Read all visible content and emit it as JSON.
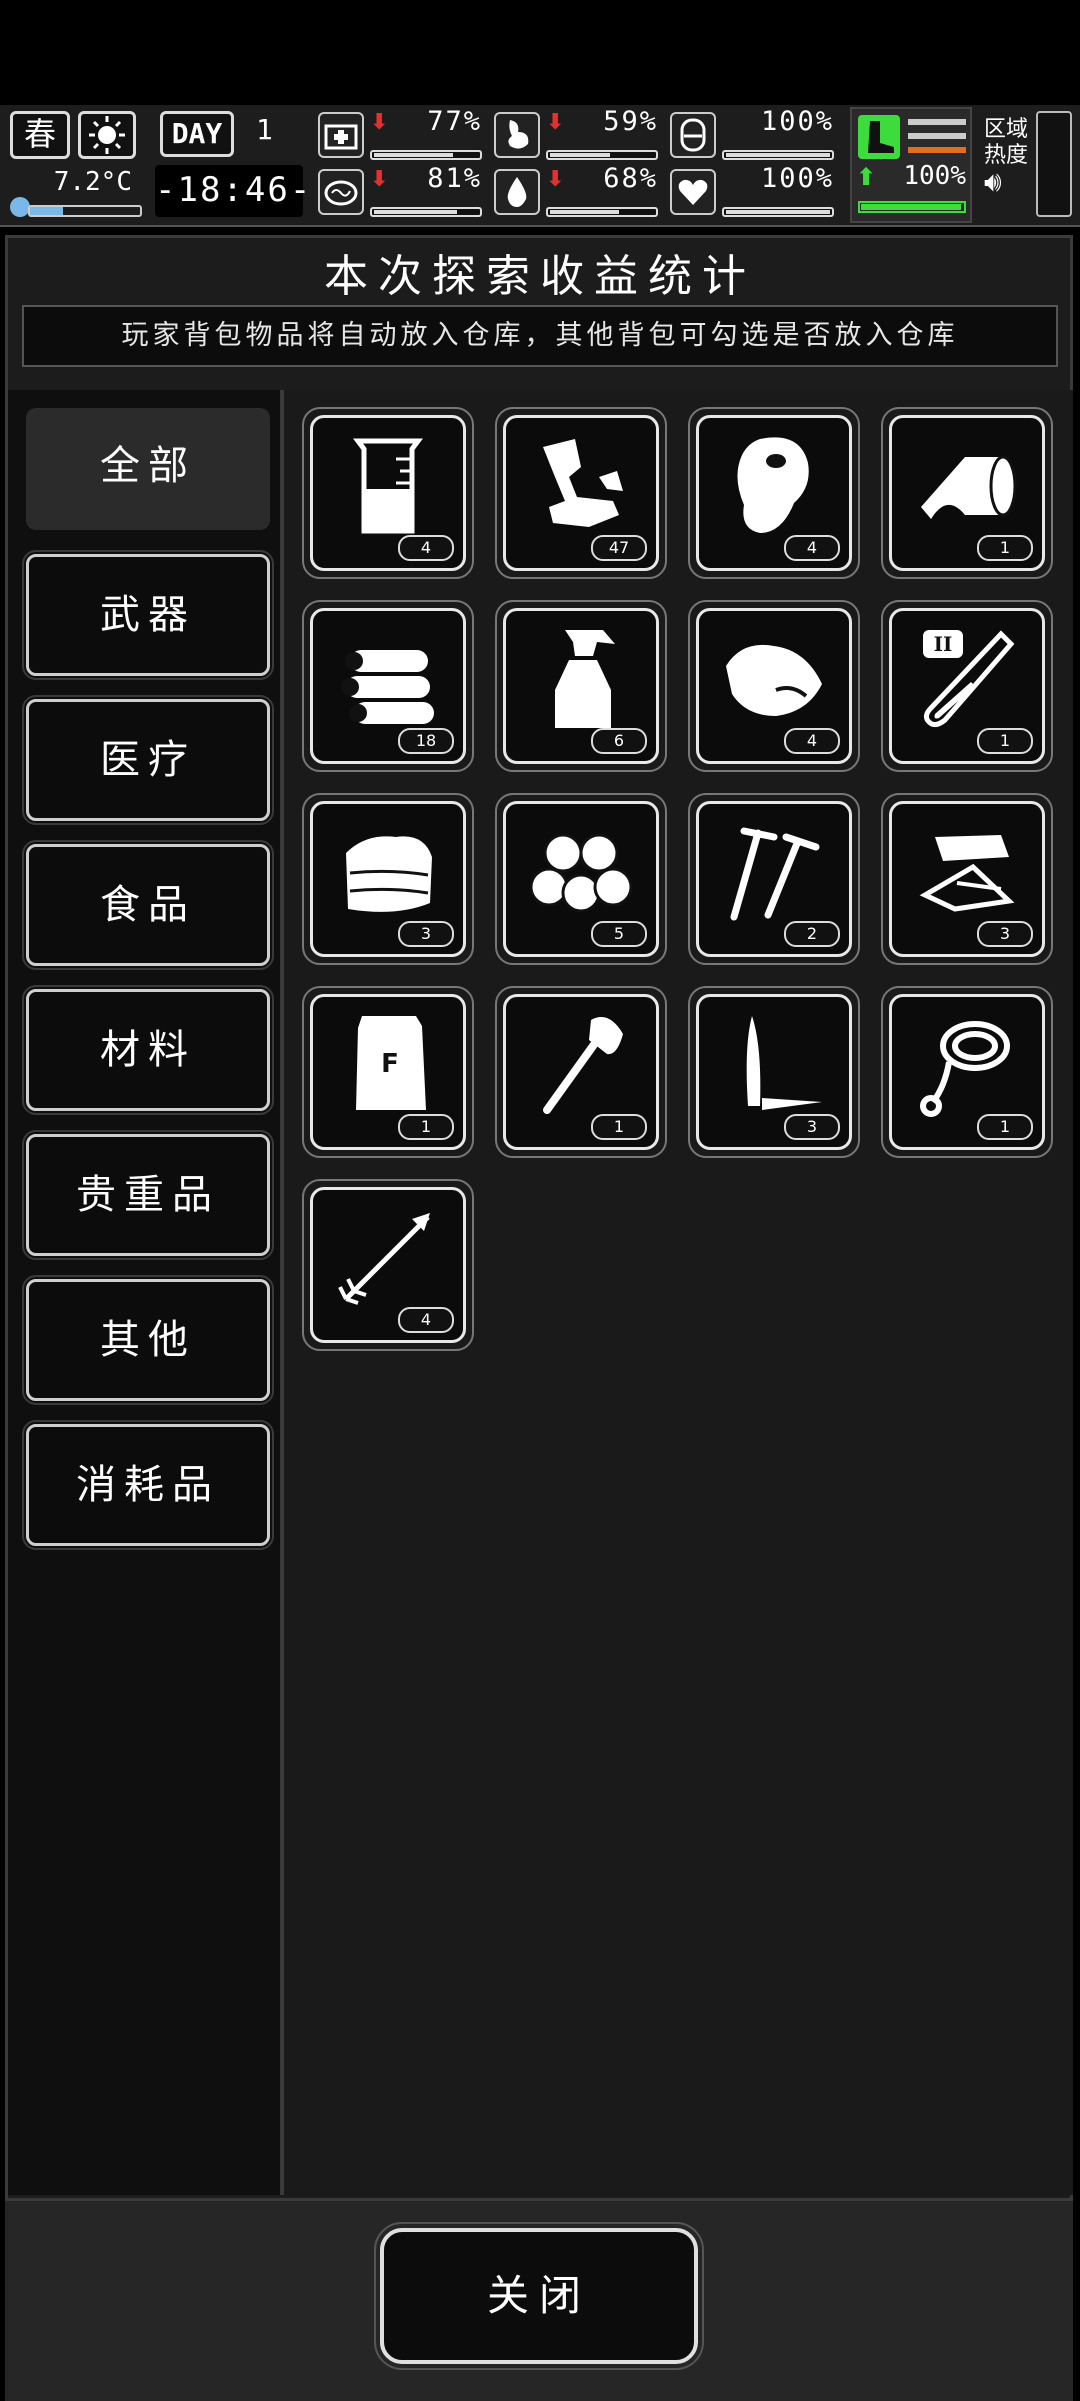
{
  "hud": {
    "season": "春",
    "temperature": "7.2°C",
    "day_label": "DAY",
    "day_number": "1",
    "time": "-18:46-",
    "stats": [
      {
        "name": "health",
        "icon": "medkit-icon",
        "arrow": "down",
        "value": "77%",
        "level": 0.77
      },
      {
        "name": "hunger",
        "icon": "stomach-icon",
        "arrow": "down",
        "value": "59%",
        "level": 0.59
      },
      {
        "name": "mood",
        "icon": "head-icon",
        "arrow": "",
        "value": "100%",
        "level": 1.0
      },
      {
        "name": "energy",
        "icon": "brain-icon",
        "arrow": "down",
        "value": "81%",
        "level": 0.81
      },
      {
        "name": "thirst",
        "icon": "water-drop-icon",
        "arrow": "down",
        "value": "68%",
        "level": 0.68
      },
      {
        "name": "heart",
        "icon": "heart-icon",
        "arrow": "",
        "value": "100%",
        "level": 1.0
      }
    ],
    "stamina": {
      "arrow": "up",
      "value": "100%",
      "level": 1.0,
      "color": "#3ddc3d"
    },
    "region_label_1": "区域",
    "region_label_2": "热度"
  },
  "title": "本次探索收益统计",
  "notice": "玩家背包物品将自动放入仓库，其他背包可勾选是否放入仓库",
  "tabs": [
    {
      "label": "全部",
      "active": true
    },
    {
      "label": "武器",
      "active": false
    },
    {
      "label": "医疗",
      "active": false
    },
    {
      "label": "食品",
      "active": false
    },
    {
      "label": "材料",
      "active": false
    },
    {
      "label": "贵重品",
      "active": false
    },
    {
      "label": "其他",
      "active": false
    },
    {
      "label": "消耗品",
      "active": false
    }
  ],
  "items": [
    {
      "icon": "beaker-icon",
      "qty": "4"
    },
    {
      "icon": "scrap-metal-icon",
      "qty": "47"
    },
    {
      "icon": "raw-meat-icon",
      "qty": "4"
    },
    {
      "icon": "bandage-roll-icon",
      "qty": "1"
    },
    {
      "icon": "logs-icon",
      "qty": "18"
    },
    {
      "icon": "spray-bottle-icon",
      "qty": "6"
    },
    {
      "icon": "cooked-meat-icon",
      "qty": "4"
    },
    {
      "icon": "test-tube-icon",
      "qty": "1"
    },
    {
      "icon": "cloth-icon",
      "qty": "3"
    },
    {
      "icon": "cotton-icon",
      "qty": "5"
    },
    {
      "icon": "screws-icon",
      "qty": "2"
    },
    {
      "icon": "paper-icon",
      "qty": "3"
    },
    {
      "icon": "fertilizer-bag-icon",
      "qty": "1"
    },
    {
      "icon": "axe-icon",
      "qty": "1"
    },
    {
      "icon": "knife-icon",
      "qty": "3"
    },
    {
      "icon": "rope-icon",
      "qty": "1"
    },
    {
      "icon": "arrow-icon",
      "qty": "4"
    }
  ],
  "close_label": "关闭"
}
